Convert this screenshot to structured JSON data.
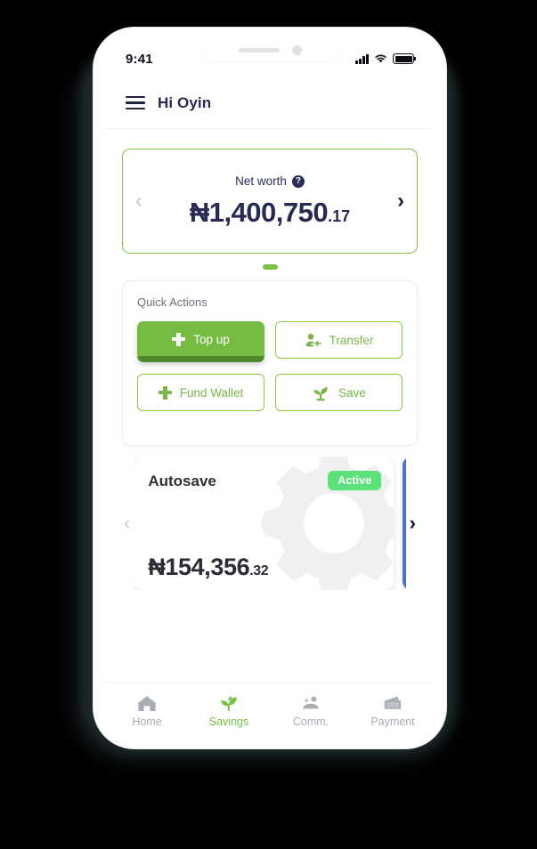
{
  "status_bar": {
    "time": "9:41",
    "icons": [
      "signal-bars-icon",
      "wifi-icon",
      "battery-icon"
    ]
  },
  "header": {
    "menu_icon": "hamburger-menu-icon",
    "greeting": "Hi Oyin"
  },
  "net_worth_card": {
    "label": "Net worth",
    "help_icon": "question-mark-icon",
    "amount_whole": "₦1,400,750",
    "amount_cents": ".17",
    "prev_icon": "chevron-left-icon",
    "next_icon": "chevron-right-icon",
    "border_color": "#7fc241",
    "text_color": "#272a52",
    "pagination_active_color": "#7ec242"
  },
  "quick_actions": {
    "title": "Quick Actions",
    "buttons": [
      {
        "label": "Top up",
        "icon": "plus-icon",
        "style": "primary"
      },
      {
        "label": "Transfer",
        "icon": "person-transfer-icon",
        "style": "outline"
      },
      {
        "label": "Fund Wallet",
        "icon": "plus-icon",
        "style": "outline"
      },
      {
        "label": "Save",
        "icon": "seedling-icon",
        "style": "outline"
      }
    ],
    "primary_color": "#76bc43",
    "primary_shadow_color": "#4e8a2b",
    "outline_color": "#8cc63f"
  },
  "savings_carousel": {
    "prev_icon": "chevron-left-icon",
    "next_icon": "chevron-right-icon",
    "cards": [
      {
        "title": "Autosave",
        "badge": "Active",
        "badge_color": "#5ce07a",
        "amount_whole": "₦154,356",
        "amount_cents": ".32",
        "watermark_icon": "gear-icon"
      },
      {
        "title": "",
        "color": "#4a72cc"
      }
    ]
  },
  "bottom_nav": {
    "items": [
      {
        "label": "Home",
        "icon": "home-icon",
        "active": false
      },
      {
        "label": "Savings",
        "icon": "plant-icon",
        "active": true
      },
      {
        "label": "Comm.",
        "icon": "people-icon",
        "active": false
      },
      {
        "label": "Payment",
        "icon": "wallet-icon",
        "active": false
      }
    ],
    "active_color": "#74c043",
    "inactive_color": "#a9acb3"
  }
}
